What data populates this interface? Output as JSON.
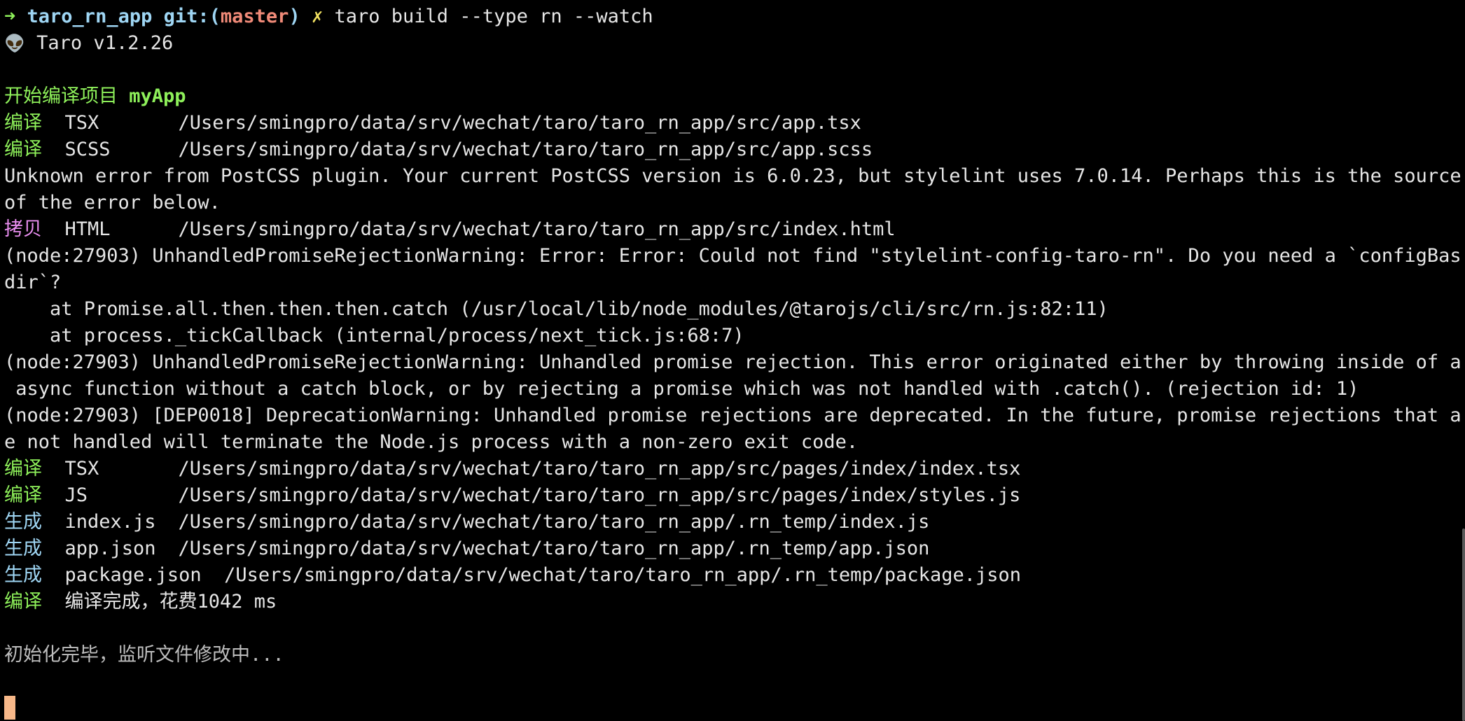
{
  "prompt": {
    "arrow": "➜",
    "dir": "taro_rn_app",
    "git_prefix": "git:(",
    "branch": "master",
    "git_suffix": ")",
    "dirty": "✗",
    "command": "taro build --type rn --watch"
  },
  "version": {
    "icon": "👽",
    "text": "Taro v1.2.26"
  },
  "start": {
    "label": "开始编译项目",
    "project": "myApp"
  },
  "lines": {
    "l1_tag": "编译",
    "l1_type": "TSX",
    "l1_path": "/Users/smingpro/data/srv/wechat/taro/taro_rn_app/src/app.tsx",
    "l2_tag": "编译",
    "l2_type": "SCSS",
    "l2_path": "/Users/smingpro/data/srv/wechat/taro/taro_rn_app/src/app.scss",
    "postcss_1": "Unknown error from PostCSS plugin. Your current PostCSS version is 6.0.23, but stylelint uses 7.0.14. Perhaps this is the source",
    "postcss_2": "of the error below.",
    "l3_tag": "拷贝",
    "l3_type": "HTML",
    "l3_path": "/Users/smingpro/data/srv/wechat/taro/taro_rn_app/src/index.html",
    "err1_1": "(node:27903) UnhandledPromiseRejectionWarning: Error: Error: Could not find \"stylelint-config-taro-rn\". Do you need a `configBase",
    "err1_2": "dir`?",
    "err1_3": "    at Promise.all.then.then.then.catch (/usr/local/lib/node_modules/@tarojs/cli/src/rn.js:82:11)",
    "err1_4": "    at process._tickCallback (internal/process/next_tick.js:68:7)",
    "err2_1": "(node:27903) UnhandledPromiseRejectionWarning: Unhandled promise rejection. This error originated either by throwing inside of an",
    "err2_2": " async function without a catch block, or by rejecting a promise which was not handled with .catch(). (rejection id: 1)",
    "err3_1": "(node:27903) [DEP0018] DeprecationWarning: Unhandled promise rejections are deprecated. In the future, promise rejections that ar",
    "err3_2": "e not handled will terminate the Node.js process with a non-zero exit code.",
    "l4_tag": "编译",
    "l4_type": "TSX",
    "l4_path": "/Users/smingpro/data/srv/wechat/taro/taro_rn_app/src/pages/index/index.tsx",
    "l5_tag": "编译",
    "l5_type": "JS",
    "l5_path": "/Users/smingpro/data/srv/wechat/taro/taro_rn_app/src/pages/index/styles.js",
    "l6_tag": "生成",
    "l6_type": "index.js",
    "l6_path": "/Users/smingpro/data/srv/wechat/taro/taro_rn_app/.rn_temp/index.js",
    "l7_tag": "生成",
    "l7_type": "app.json",
    "l7_path": "/Users/smingpro/data/srv/wechat/taro/taro_rn_app/.rn_temp/app.json",
    "l8_tag": "生成",
    "l8_type": "package.json",
    "l8_path": "/Users/smingpro/data/srv/wechat/taro/taro_rn_app/.rn_temp/package.json",
    "l9_tag": "编译",
    "l9_text": "编译完成，花费",
    "l9_ms": "1042 ms",
    "done": "初始化完毕，监听文件修改中..."
  },
  "colors": {
    "background": "#000000",
    "green": "#8ef05a",
    "cyan": "#9fd6f4",
    "red": "#f08a78",
    "magenta": "#e98ef0",
    "cursor": "#f7b889"
  }
}
